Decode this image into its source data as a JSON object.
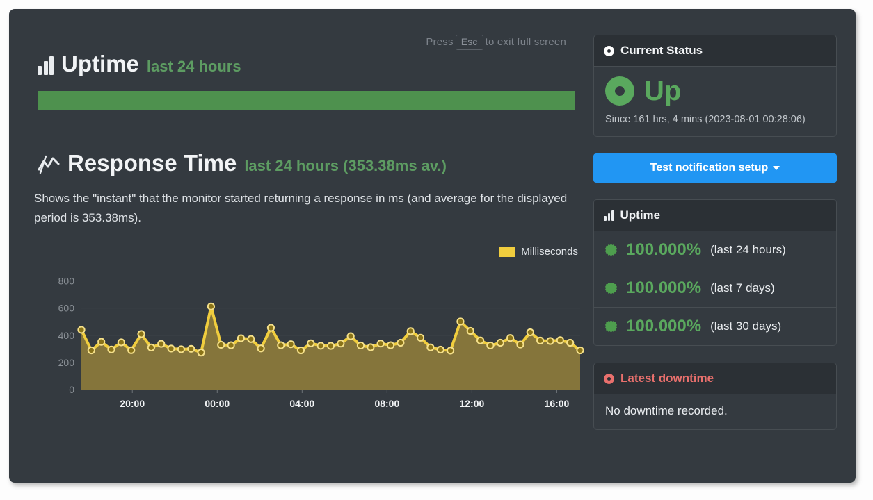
{
  "esc_hint": {
    "press": "Press",
    "key": "Esc",
    "rest": "to exit full screen"
  },
  "uptime_section": {
    "icon": "bar-chart-icon",
    "title": "Uptime",
    "subtitle": "last 24 hours",
    "bar_color": "#4e914e",
    "bar_percent": 100
  },
  "response_section": {
    "icon": "line-chart-icon",
    "title": "Response Time",
    "subtitle": "last 24 hours (353.38ms av.)",
    "description": "Shows the \"instant\" that the monitor started returning a response in ms (and average for the displayed period is 353.38ms)."
  },
  "chart_data": {
    "type": "area",
    "title": "Response Time",
    "xlabel": "",
    "ylabel": "",
    "ylim": [
      0,
      900
    ],
    "yticks": [
      0,
      200,
      400,
      600,
      800
    ],
    "xticks": [
      "20:00",
      "00:00",
      "04:00",
      "08:00",
      "12:00",
      "16:00"
    ],
    "xtick_hours": [
      20,
      24,
      28,
      32,
      36,
      40
    ],
    "x_start_hour": 17.6,
    "x_end_hour": 41.1,
    "grid": true,
    "legend": {
      "position": "top-right",
      "entries": [
        {
          "name": "Milliseconds",
          "color": "#f0cd3e"
        }
      ]
    },
    "series": [
      {
        "name": "Milliseconds",
        "line_color": "#f0cd3e",
        "fill_color": "#85753b",
        "marker_color": "#8a7318",
        "values": [
          440,
          289,
          352,
          295,
          348,
          290,
          409,
          310,
          337,
          302,
          297,
          300,
          273,
          612,
          330,
          327,
          378,
          372,
          303,
          455,
          327,
          334,
          289,
          341,
          323,
          322,
          339,
          393,
          325,
          312,
          339,
          327,
          345,
          430,
          382,
          311,
          294,
          287,
          501,
          432,
          362,
          325,
          345,
          380,
          332,
          422,
          361,
          358,
          364,
          345,
          289
        ]
      }
    ]
  },
  "sidebar": {
    "current_status": {
      "header": "Current Status",
      "header_icon": "status-dot-icon",
      "status": "Up",
      "status_color": "#5aa85e",
      "since": "Since 161 hrs, 4 mins (2023-08-01 00:28:06)"
    },
    "notification_button": {
      "label": "Test notification setup",
      "color": "#2196f3",
      "icon": "chevron-down-icon"
    },
    "uptime": {
      "header": "Uptime",
      "header_icon": "bar-chart-icon",
      "rows": [
        {
          "icon": "burst-icon",
          "percent": "100.000%",
          "period": "(last 24 hours)"
        },
        {
          "icon": "burst-icon",
          "percent": "100.000%",
          "period": "(last 7 days)"
        },
        {
          "icon": "burst-icon",
          "percent": "100.000%",
          "period": "(last 30 days)"
        }
      ]
    },
    "latest_downtime": {
      "header": "Latest downtime",
      "header_icon": "status-dot-icon",
      "header_color": "#e9706d",
      "message": "No downtime recorded."
    }
  }
}
